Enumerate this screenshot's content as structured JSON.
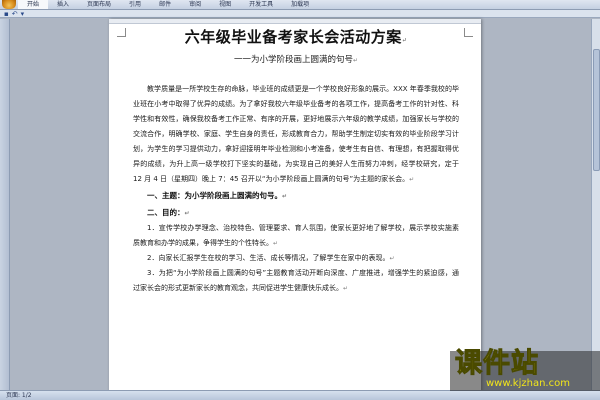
{
  "ribbon": {
    "tabs": [
      "开始",
      "插入",
      "页面布局",
      "引用",
      "邮件",
      "审阅",
      "视图",
      "开发工具",
      "加载项"
    ],
    "active_tab": "开始"
  },
  "document": {
    "title": "六年级毕业备考家长会活动方案",
    "subtitle": "一一为小学阶段画上圆满的句号",
    "paragraphs": [
      "教学质量是一所学校生存的命脉，毕业班的成绩更是一个学校良好形象的展示。XXX 年春季我校的毕业班在小考中取得了优异的成绩。为了拿好我校六年级毕业备考的各项工作，提高备考工作的针对性、科学性和有效性，确保我校备考工作正常、有序的开展，更好地展示六年级的教学成绩，加强家长与学校的交流合作，明确学校、家庭、学生自身的责任，形成教育合力，帮助学生制定切实有效的毕业阶段学习计划，为学生的学习提供动力，拿好迎接明年毕业检测和小考准备，使考生有自信、有理想，有把握取得优异的成绩，为升上高一级学校打下坚实的基础，为实现自己的美好人生而努力冲刺，经学校研究，定于 12 月 4 日（星期四）晚上 7：45 召开以“为小学阶段画上圆满的句号”为主题的家长会。"
    ],
    "section1_heading": "一、主题：为小学阶段画上圆满的句号。",
    "section2_heading": "二、目的：",
    "items": [
      "1．宣传学校办学理念、治校特色、管理要求、育人氛围，使家长更好地了解学校，展示学校实施素质教育和办学的成果，争得学生的个性特长。",
      "2．向家长汇报学生在校的学习、生活、成长等情况，了解学生在家中的表现。",
      "3．为把“为小学阶段画上圆满的句号”主题教育活动开断向深度、广度推进，增强学生的紧迫感，通过家长会的形式更新家长的教育观念，共同促进学生健康快乐成长。"
    ]
  },
  "status_bar": {
    "page": "页面: 1/2"
  },
  "watermark": {
    "brand": "课件站",
    "url": "www.kjzhan.com"
  }
}
